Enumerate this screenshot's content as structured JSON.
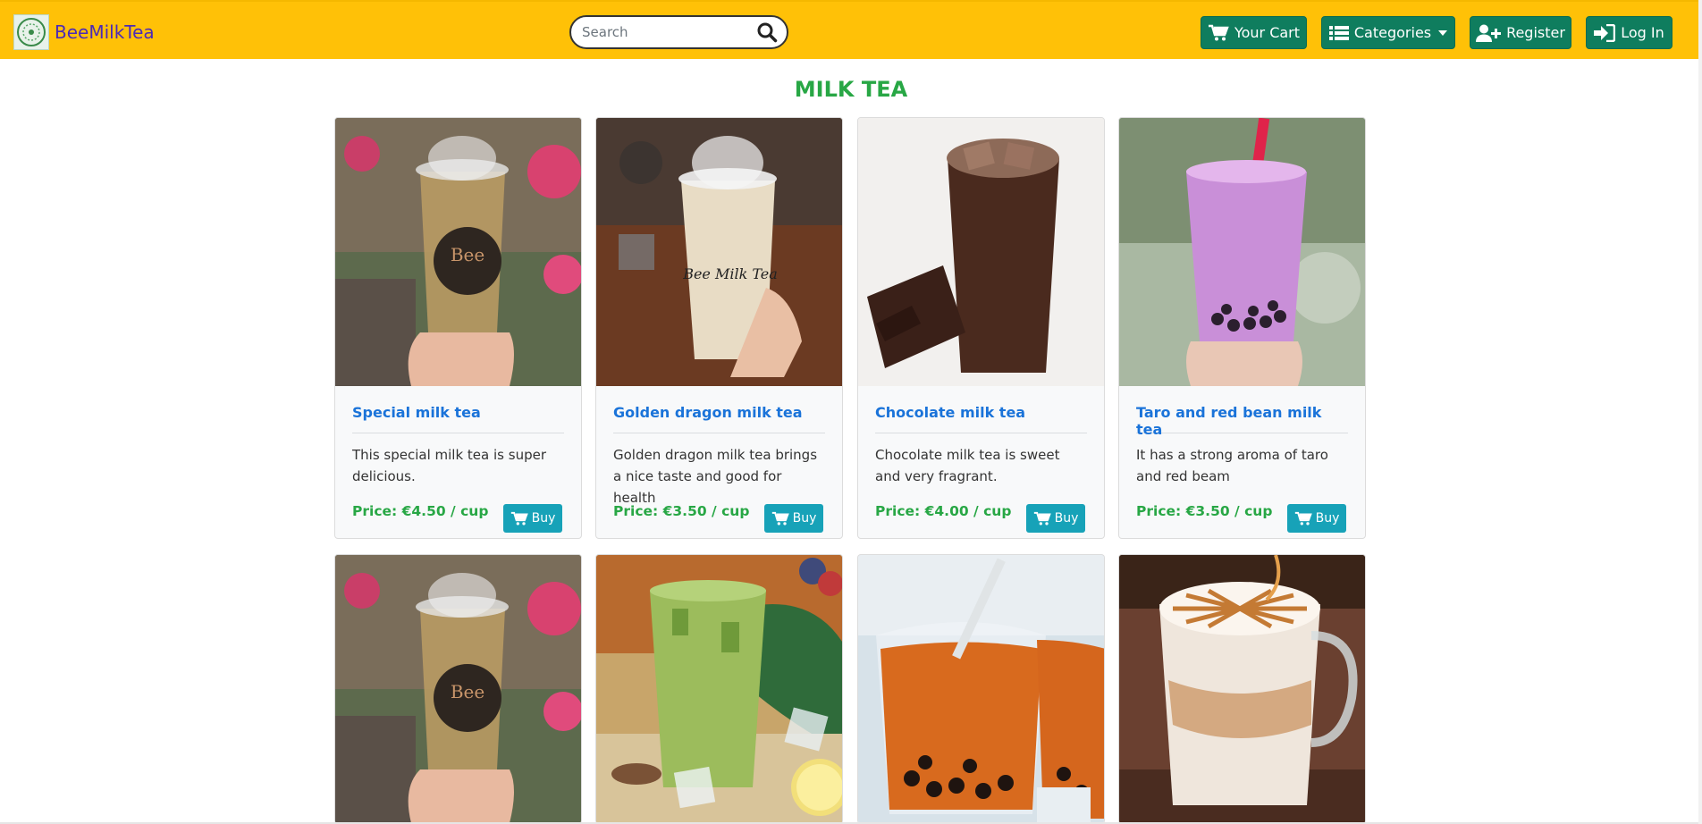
{
  "navbar": {
    "brand_name": "BeeMilkTea",
    "search_placeholder": "Search",
    "cart_label": "Your Cart",
    "categories_label": "Categories",
    "register_label": "Register",
    "login_label": "Log In",
    "background_color": "#ffc107",
    "button_color": "#0f7d5e"
  },
  "page": {
    "title": "MILK TEA",
    "title_color": "#28a745"
  },
  "products": [
    {
      "name": "Special milk tea",
      "description": "This special milk tea is super delicious.",
      "price": "Price: €4.50 / cup",
      "buy_label": "Buy",
      "image": "clear-cup-held-in-hand-with-pink-flowers"
    },
    {
      "name": "Golden dragon milk tea",
      "description": "Golden dragon milk tea brings a nice taste and good for health",
      "price": "Price: €3.50 / cup",
      "buy_label": "Buy",
      "image": "milky-tea-cup-with-logo"
    },
    {
      "name": "Chocolate milk tea",
      "description": "Chocolate milk tea is sweet and very fragrant.",
      "price": "Price: €4.00 / cup",
      "buy_label": "Buy",
      "image": "chocolate-iced-drink-with-chocolate-bar"
    },
    {
      "name": "Taro and red bean milk tea",
      "description": "It has a strong aroma of taro and red beam",
      "price": "Price: €3.50 / cup",
      "buy_label": "Buy",
      "image": "purple-taro-tea-with-pearls"
    },
    {
      "image": "clear-cup-held-in-hand-with-pink-flowers"
    },
    {
      "image": "green-matcha-iced-tea"
    },
    {
      "image": "orange-thai-tea-with-pearls"
    },
    {
      "image": "caramel-latte-in-glass-mug"
    }
  ],
  "colors": {
    "price": "#28a745",
    "product_name": "#1a73d9",
    "buy_button": "#17a2b8"
  }
}
